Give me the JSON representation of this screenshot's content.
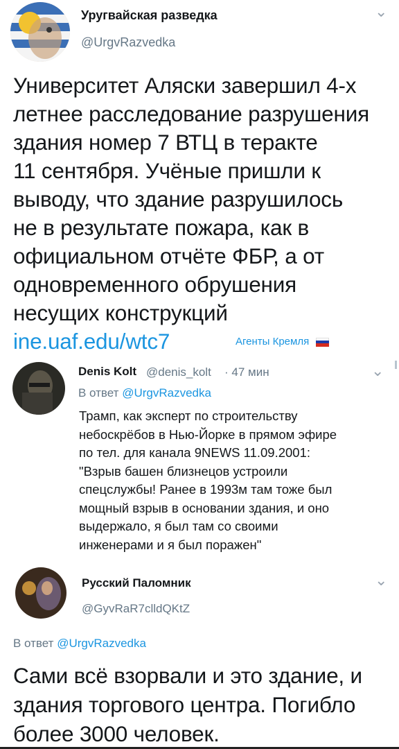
{
  "tweet": {
    "author_name": "Уругвайская разведка",
    "handle": "@UrgvRazvedka",
    "text": "Университет Аляски завершил 4-х\nлетнее расследование разрушения\nздания номер 7 ВТЦ в теракте\n11 сентября. Учёные пришли к\nвыводу, что здание разрушилось\nне в результате пожара, как в\nофициальном отчёте ФБР, а от\nодновременного обрушения\nнесущих конструкций",
    "link": "ine.uaf.edu/wtc7",
    "tag": "Агенты Кремля",
    "tag_flag": {
      "top": "#ffffff",
      "middle": "#1c3aa9",
      "bottom": "#d52b1e"
    }
  },
  "reply1": {
    "author_name": "Denis Kolt",
    "handle": "@denis_kolt",
    "time": "· 47 мин",
    "reply_prefix": "В ответ",
    "reply_handle": "@UrgvRazvedka",
    "text": "Трамп, как эксперт по строительству\nнебоскрёбов в Нью-Йорке в прямом эфире\nпо тел. для канала 9NEWS 11.09.2001:\n\"Взрыв башен близнецов устроили\nспецслужбы! Ранее в 1993м там тоже был\nмощный взрыв в основании здания, и оно\nвыдержало, я был там со своими\nинженерами и я был поражен\""
  },
  "reply2": {
    "author_name": "Русский Паломник",
    "handle": "@GyvRaR7clldQKtZ",
    "reply_prefix": "В ответ",
    "reply_handle": "@UrgvRazvedka",
    "text": "Сами всё взорвали и это здание, и\nздания торгового центра. Погибло\nболее 3000 человек."
  },
  "icons": {
    "chevron": "⌄"
  }
}
